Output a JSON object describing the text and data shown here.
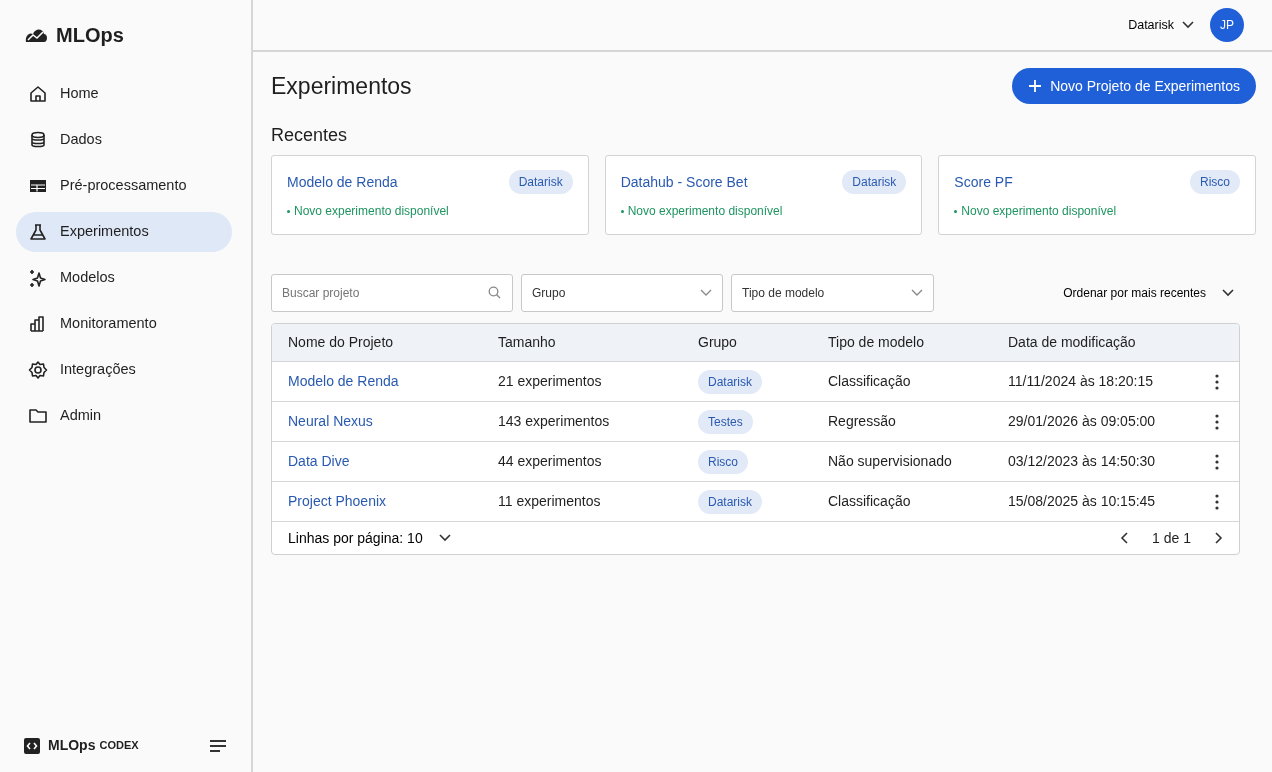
{
  "brand": {
    "name": "MLOps"
  },
  "sidebar": {
    "items": [
      {
        "label": "Home",
        "selected": false
      },
      {
        "label": "Dados",
        "selected": false
      },
      {
        "label": "Pré-processamento",
        "selected": false
      },
      {
        "label": "Experimentos",
        "selected": true
      },
      {
        "label": "Modelos",
        "selected": false
      },
      {
        "label": "Monitoramento",
        "selected": false
      },
      {
        "label": "Integrações",
        "selected": false
      },
      {
        "label": "Admin",
        "selected": false
      }
    ],
    "footer": {
      "name": "MLOps",
      "suffix": "CODEX"
    }
  },
  "header": {
    "org": "Datarisk",
    "avatar": "JP"
  },
  "page": {
    "title": "Experimentos",
    "new_button": "Novo Projeto de Experimentos"
  },
  "recents": {
    "title": "Recentes",
    "cards": [
      {
        "name": "Modelo de Renda",
        "group": "Datarisk",
        "status": "Novo experimento disponível"
      },
      {
        "name": "Datahub - Score Bet",
        "group": "Datarisk",
        "status": "Novo experimento disponível"
      },
      {
        "name": "Score PF",
        "group": "Risco",
        "status": "Novo experimento disponível"
      }
    ]
  },
  "filters": {
    "search_placeholder": "Buscar projeto",
    "group_placeholder": "Grupo",
    "type_placeholder": "Tipo de modelo",
    "sort": "Ordenar por mais recentes"
  },
  "table": {
    "columns": [
      "Nome do Projeto",
      "Tamanho",
      "Grupo",
      "Tipo de modelo",
      "Data de modificação"
    ],
    "rows": [
      {
        "name": "Modelo de Renda",
        "size": "21 experimentos",
        "group": "Datarisk",
        "type": "Classificação",
        "date": "11/11/2024 às 18:20:15"
      },
      {
        "name": "Neural Nexus",
        "size": "143 experimentos",
        "group": "Testes",
        "type": "Regressão",
        "date": "29/01/2026 às 09:05:00"
      },
      {
        "name": "Data Dive",
        "size": "44 experimentos",
        "group": "Risco",
        "type": "Não supervisionado",
        "date": "03/12/2023 às 14:50:30"
      },
      {
        "name": "Project Phoenix",
        "size": "11 experimentos",
        "group": "Datarisk",
        "type": "Classificação",
        "date": "15/08/2025 às 10:15:45"
      }
    ],
    "rows_per_page": "Linhas por página: 10",
    "page_info": "1 de 1"
  }
}
